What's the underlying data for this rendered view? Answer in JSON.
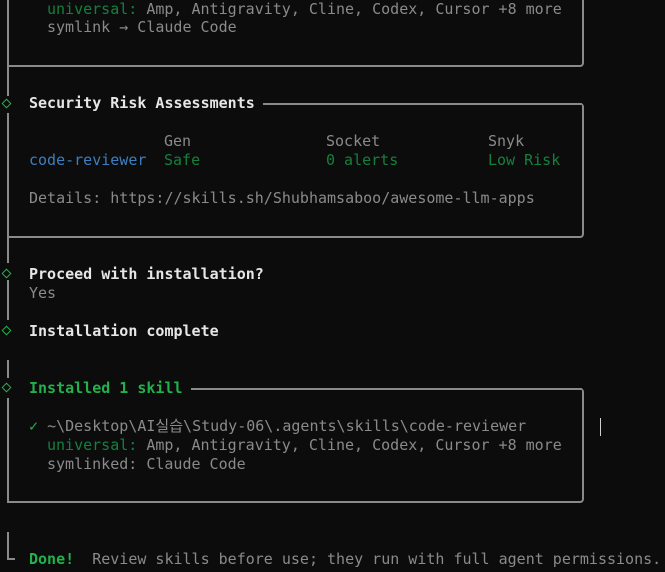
{
  "top_block": {
    "universal_label": "universal:",
    "universal_agents": " Amp, Antigravity, Cline, Codex, Cursor +8 more",
    "symlink_text": "symlink → Claude Code"
  },
  "security": {
    "title": "Security Risk Assessments",
    "columns": [
      "Gen",
      "Socket",
      "Snyk"
    ],
    "row": {
      "skill": "code-reviewer",
      "gen": "Safe",
      "socket": "0 alerts",
      "snyk": "Low Risk"
    },
    "details_text": "Details: https://skills.sh/Shubhamsaboo/awesome-llm-apps"
  },
  "proceed": {
    "question": "Proceed with installation?",
    "answer": "Yes"
  },
  "install_complete": {
    "text": "Installation complete"
  },
  "installed": {
    "title": "Installed 1 skill",
    "check": "✓",
    "path": "~\\Desktop\\AI실습\\Study-06\\.agents\\skills\\code-reviewer",
    "universal_label": "universal:",
    "universal_agents": " Amp, Antigravity, Cline, Codex, Cursor +8 more",
    "symlinked_text": "symlinked: Claude Code"
  },
  "done": {
    "label": "Done!",
    "message": "  Review skills before use; they run with full agent permissions."
  },
  "colors": {
    "background": "#0c0c0c",
    "green_accent": "#22b14c",
    "dark_green": "#15803d",
    "blue_skill": "#3c7fbf",
    "gray_border": "#8a8a8a"
  }
}
